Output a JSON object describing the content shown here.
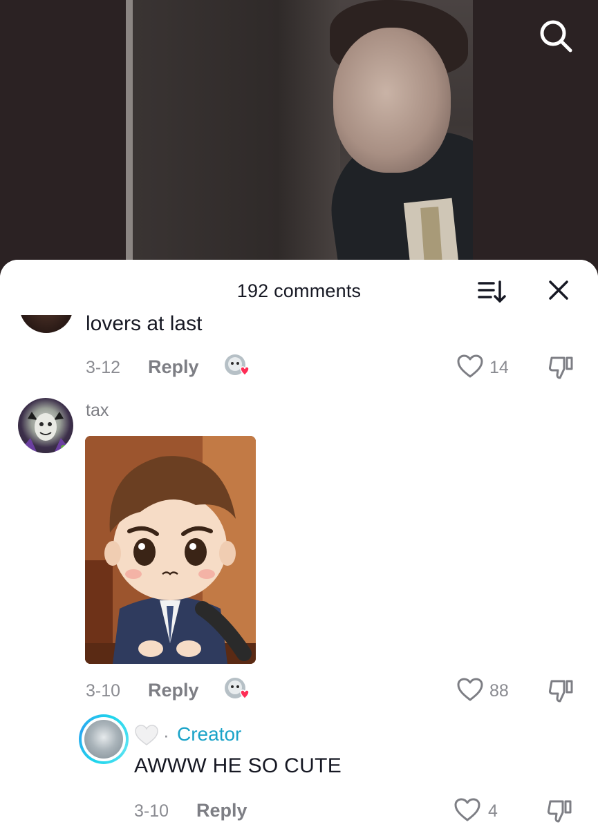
{
  "header": {
    "comment_count": "192 comments"
  },
  "icons": {
    "search": "search-icon",
    "sort": "sort-icon",
    "close": "close-icon",
    "like": "heart-outline-icon",
    "dislike": "thumbs-down-icon",
    "creator_liked": "heart-icon"
  },
  "colors": {
    "creator_label": "#1aa3c8",
    "liked_heart": "#fe2c55",
    "text_primary": "#161823",
    "text_secondary": "#8a8b91"
  },
  "comments": [
    {
      "text": "lovers at last",
      "date": "3-12",
      "reply_label": "Reply",
      "likes": "14",
      "liked_by_creator": true
    },
    {
      "username": "tax",
      "attachment": "sticker",
      "date": "3-10",
      "reply_label": "Reply",
      "likes": "88",
      "liked_by_creator": true,
      "replies": [
        {
          "badge": "Creator",
          "separator": "·",
          "text": "AWWW HE SO CUTE",
          "date": "3-10",
          "reply_label": "Reply",
          "likes": "4"
        }
      ]
    }
  ]
}
